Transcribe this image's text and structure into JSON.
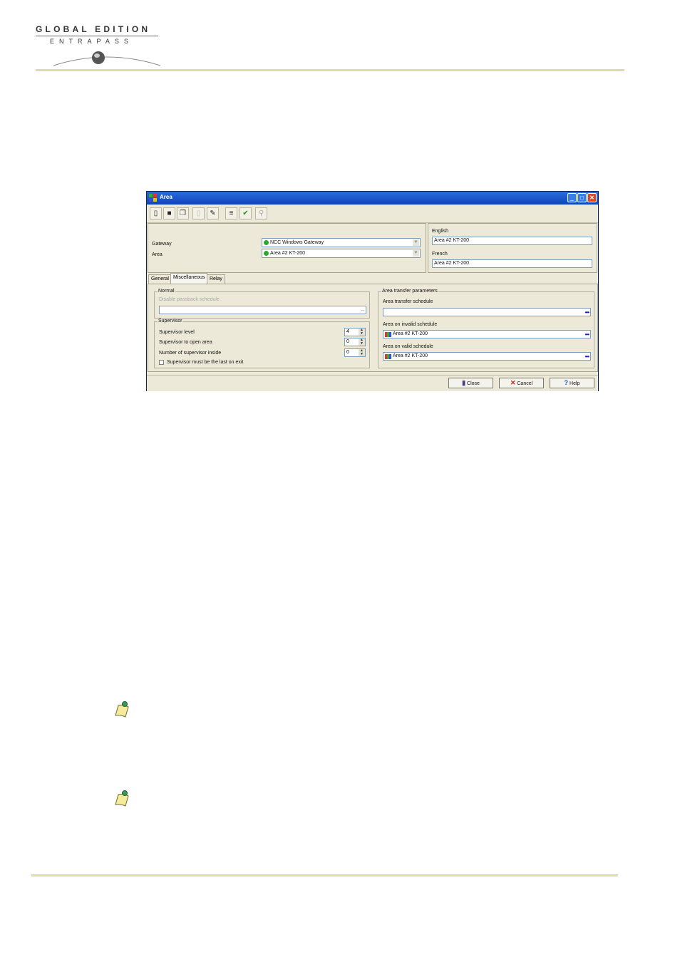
{
  "header": {
    "logo_top": "GLOBAL EDITION",
    "logo_sub": "ENTRAPASS"
  },
  "window": {
    "title": "Area",
    "toolbar": [
      {
        "icon": "new-icon",
        "glyph": "▯"
      },
      {
        "icon": "save-icon",
        "glyph": "■"
      },
      {
        "icon": "copy-icon",
        "glyph": "❐"
      },
      {
        "icon": "delete-icon",
        "glyph": "▯"
      },
      {
        "icon": "print-icon",
        "glyph": "✎"
      },
      {
        "icon": "list-icon",
        "glyph": "≡"
      },
      {
        "icon": "link-icon",
        "glyph": "✔"
      },
      {
        "icon": "find-icon",
        "glyph": "⚲"
      }
    ],
    "gateway_label": "Gateway",
    "gateway_value": "NCC Windows Gateway",
    "area_label": "Area",
    "area_value": "Area #2 KT-200",
    "english_label": "English",
    "english_value": "Area #2 KT-200",
    "french_label": "French",
    "french_value": "Area #2 KT-200",
    "tabs": [
      "General",
      "Miscellaneous",
      "Relay"
    ],
    "normal_group": "Normal",
    "disable_passback_label": "Disable passback schedule",
    "supervisor_group": "Supervisor",
    "supervisor_level_label": "Supervisor level",
    "supervisor_level_value": "4",
    "supervisor_open_label": "Supervisor to open area",
    "supervisor_open_value": "0",
    "supervisor_inside_label": "Number of supervisor inside",
    "supervisor_inside_value": "0",
    "supervisor_last_label": "Supervisor must be the last on exit",
    "transfer_group": "Area transfer parameters",
    "transfer_schedule_label": "Area transfer schedule",
    "invalid_label": "Area on invalid schedule",
    "invalid_value": "Area #2 KT-200",
    "valid_label": "Area on valid schedule",
    "valid_value": "Area #2 KT-200",
    "close_label": "Close",
    "cancel_label": "Cancel",
    "help_label": "Help"
  }
}
